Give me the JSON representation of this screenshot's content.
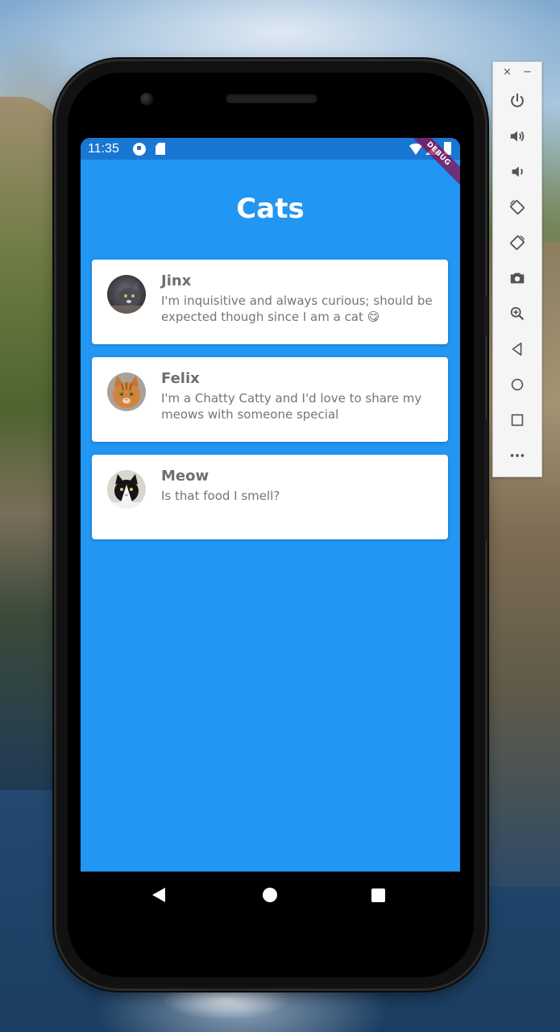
{
  "status_bar": {
    "time": "11:35"
  },
  "debug_banner": "DEBUG",
  "app": {
    "title": "Cats",
    "cats": [
      {
        "name": "Jinx",
        "description": "I'm inquisitive and always curious; should be expected though since I am a cat 😋",
        "avatar": "grey-cat-photo"
      },
      {
        "name": "Felix",
        "description": "I'm a Chatty Catty and I'd love to share my meows with someone special",
        "avatar": "orange-tabby-cat-photo"
      },
      {
        "name": "Meow",
        "description": "Is that food I smell?",
        "avatar": "black-white-cat-photo"
      }
    ]
  },
  "navigation": {
    "icons": [
      "back-icon",
      "home-icon",
      "recent-apps-icon"
    ]
  },
  "emulator_toolbar": {
    "close_label": "×",
    "minimize_label": "−",
    "icons": [
      "power-icon",
      "volume-up-icon",
      "volume-down-icon",
      "rotate-left-icon",
      "rotate-right-icon",
      "camera-icon",
      "zoom-icon",
      "back-icon",
      "home-icon",
      "overview-icon",
      "more-icon"
    ]
  },
  "colors": {
    "app_background": "#2196f3",
    "status_bar": "#1976d2",
    "card": "#ffffff",
    "title_text": "#ffffff",
    "name_text": "#6f6f6f",
    "desc_text": "#757575"
  }
}
